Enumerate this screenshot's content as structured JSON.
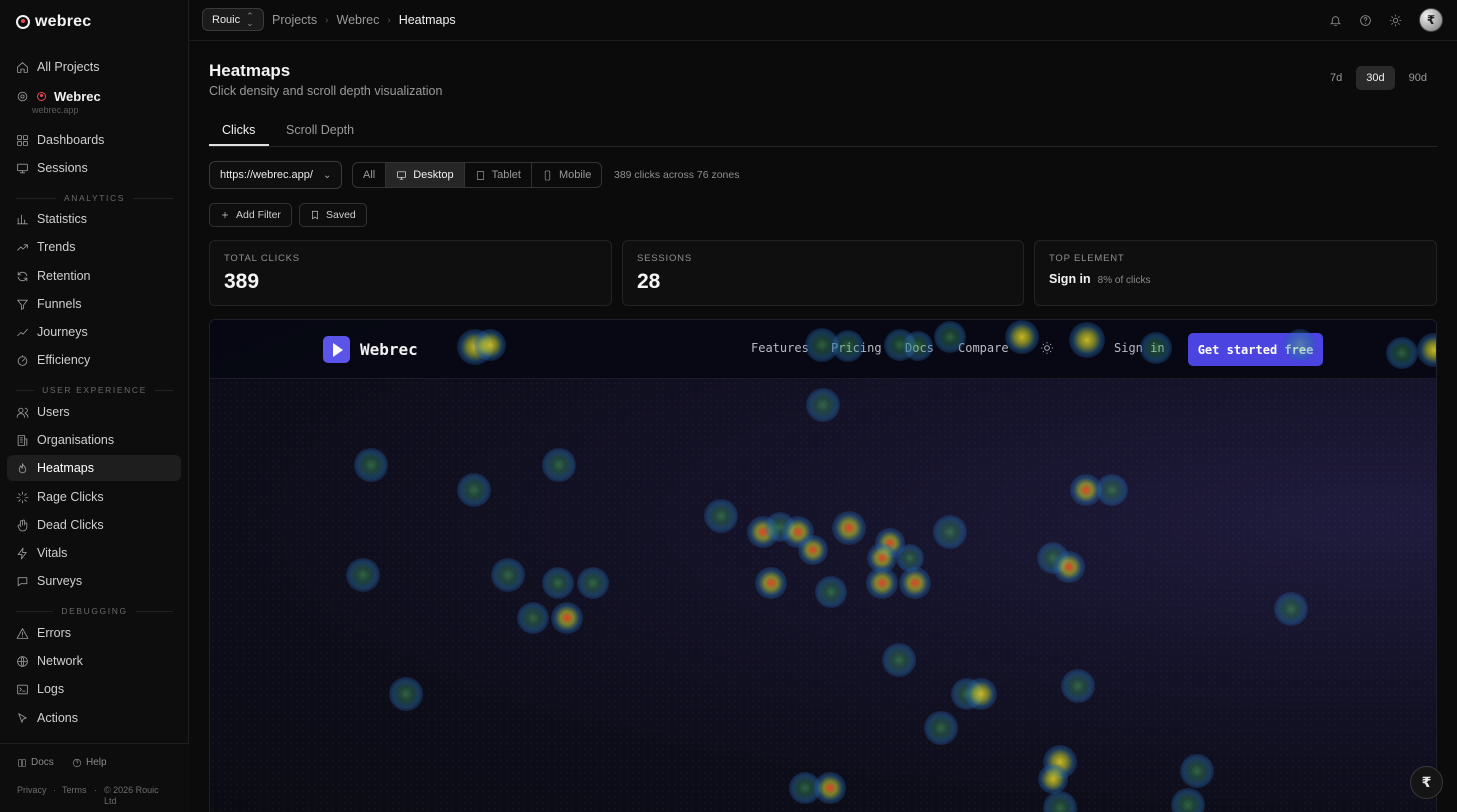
{
  "app": {
    "logo_text": "webrec"
  },
  "sidebar": {
    "all_projects": "All Projects",
    "project_name": "Webrec",
    "project_domain": "webrec.app",
    "items_top": [
      {
        "label": "Dashboards",
        "icon": "grid-icon"
      },
      {
        "label": "Sessions",
        "icon": "monitor-icon"
      }
    ],
    "sections": [
      {
        "label": "ANALYTICS",
        "items": [
          {
            "label": "Statistics",
            "icon": "bar-chart-icon"
          },
          {
            "label": "Trends",
            "icon": "trend-icon"
          },
          {
            "label": "Retention",
            "icon": "refresh-icon"
          },
          {
            "label": "Funnels",
            "icon": "funnel-icon"
          },
          {
            "label": "Journeys",
            "icon": "route-icon"
          },
          {
            "label": "Efficiency",
            "icon": "gauge-icon"
          }
        ]
      },
      {
        "label": "USER EXPERIENCE",
        "items": [
          {
            "label": "Users",
            "icon": "users-icon"
          },
          {
            "label": "Organisations",
            "icon": "building-icon"
          },
          {
            "label": "Heatmaps",
            "icon": "flame-icon",
            "active": true
          },
          {
            "label": "Rage Clicks",
            "icon": "burst-icon"
          },
          {
            "label": "Dead Clicks",
            "icon": "hand-icon"
          },
          {
            "label": "Vitals",
            "icon": "bolt-icon"
          },
          {
            "label": "Surveys",
            "icon": "chat-icon"
          }
        ]
      },
      {
        "label": "DEBUGGING",
        "items": [
          {
            "label": "Errors",
            "icon": "warning-icon"
          },
          {
            "label": "Network",
            "icon": "globe-icon"
          },
          {
            "label": "Logs",
            "icon": "terminal-icon"
          },
          {
            "label": "Actions",
            "icon": "cursor-icon"
          }
        ]
      }
    ],
    "footer": {
      "docs": "Docs",
      "help": "Help",
      "privacy": "Privacy",
      "terms": "Terms",
      "copyright": "© 2026 Rouic Ltd"
    }
  },
  "topbar": {
    "org": "Rouic",
    "breadcrumb": [
      "Projects",
      "Webrec",
      "Heatmaps"
    ]
  },
  "page": {
    "title": "Heatmaps",
    "subtitle": "Click density and scroll depth visualization",
    "ranges": [
      "7d",
      "30d",
      "90d"
    ],
    "active_range": "30d",
    "tabs": [
      "Clicks",
      "Scroll Depth"
    ],
    "active_tab": "Clicks",
    "url": "https://webrec.app/",
    "devices": [
      "All",
      "Desktop",
      "Tablet",
      "Mobile"
    ],
    "active_device": "Desktop",
    "click_summary": "389 clicks across 76 zones",
    "add_filter": "Add Filter",
    "saved": "Saved"
  },
  "stats": {
    "total_clicks_label": "TOTAL CLICKS",
    "total_clicks": "389",
    "sessions_label": "SESSIONS",
    "sessions": "28",
    "top_element_label": "TOP ELEMENT",
    "top_element": "Sign in",
    "top_element_share": "8% of clicks"
  },
  "preview": {
    "logo": "Webrec",
    "links": [
      "Features",
      "Pricing",
      "Docs",
      "Compare"
    ],
    "sign_in": "Sign in",
    "cta": "Get started free"
  },
  "colors": {
    "accent": "#4b44e0",
    "brand_red": "#e8484f"
  }
}
